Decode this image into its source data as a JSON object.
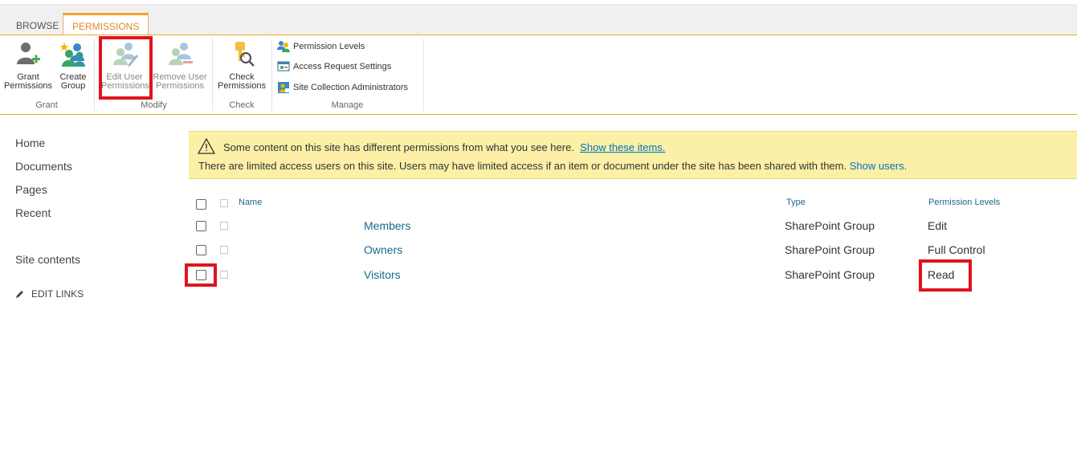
{
  "tabs": {
    "browse": "BROWSE",
    "permissions": "PERMISSIONS"
  },
  "ribbon": {
    "grant_permissions": [
      "Grant",
      "Permissions"
    ],
    "create_group": [
      "Create",
      "Group"
    ],
    "edit_user_permissions": [
      "Edit User",
      "Permissions"
    ],
    "remove_user_permissions": [
      "Remove User",
      "Permissions"
    ],
    "check_permissions": [
      "Check",
      "Permissions"
    ],
    "permission_levels": "Permission Levels",
    "access_request_settings": "Access Request Settings",
    "site_collection_administrators": "Site Collection Administrators",
    "groups": {
      "grant": "Grant",
      "modify": "Modify",
      "check": "Check",
      "manage": "Manage"
    }
  },
  "nav": {
    "home": "Home",
    "documents": "Documents",
    "pages": "Pages",
    "recent": "Recent",
    "site_contents": "Site contents",
    "edit_links": "EDIT LINKS"
  },
  "notice": {
    "line1_text": "Some content on this site has different permissions from what you see here.",
    "line1_link": "Show these items.",
    "line2_text": "There are limited access users on this site. Users may have limited access if an item or document under the site has been shared with them.",
    "line2_link": "Show users."
  },
  "table": {
    "headers": {
      "name": "Name",
      "type": "Type",
      "permission_levels": "Permission Levels"
    },
    "rows": [
      {
        "name": "Members",
        "type": "SharePoint Group",
        "level": "Edit"
      },
      {
        "name": "Owners",
        "type": "SharePoint Group",
        "level": "Full Control"
      },
      {
        "name": "Visitors",
        "type": "SharePoint Group",
        "level": "Read"
      }
    ]
  },
  "icons": {
    "grant": "grant-permissions-icon",
    "group": "create-group-icon",
    "edit": "edit-user-permissions-icon",
    "remove": "remove-user-permissions-icon",
    "check": "check-permissions-icon",
    "warning": "warning-icon",
    "pencil": "pencil-icon"
  },
  "colors": {
    "accent": "#f7a02f",
    "link": "#1a6a8c",
    "highlight": "#e0141e",
    "notice_bg": "#fbf0a6"
  }
}
